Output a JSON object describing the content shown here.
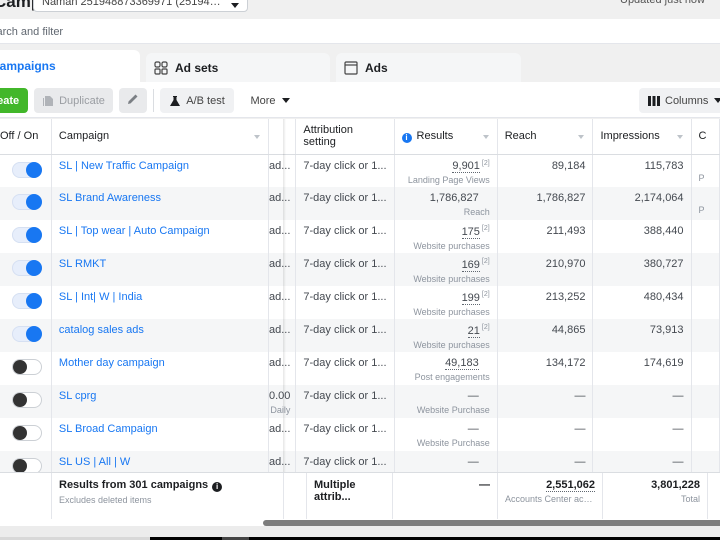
{
  "header": {
    "title": "Campaigns",
    "account_selector": "Naman 251948873369971 (251948873...",
    "updated_status": "Updated just now"
  },
  "search": {
    "placeholder": "Search and filter"
  },
  "tabs": [
    {
      "label": "Campaigns",
      "icon": "campaigns-icon",
      "active": true
    },
    {
      "label": "Ad sets",
      "icon": "grid-icon",
      "active": false
    },
    {
      "label": "Ads",
      "icon": "ad-window-icon",
      "active": false
    }
  ],
  "toolbar": {
    "create_label": "Create",
    "duplicate_label": "Duplicate",
    "edit_icon": "pencil-icon",
    "ab_test_label": "A/B test",
    "more_label": "More",
    "columns_label": "Columns"
  },
  "table": {
    "columns": {
      "toggle": "Off / On",
      "campaign": "Campaign",
      "budget": "",
      "attribution": "Attribution setting",
      "results": "Results",
      "reach": "Reach",
      "impressions": "Impressions",
      "next": "C"
    },
    "rows": [
      {
        "on": true,
        "name": "SL | New Traffic Campaign",
        "budget": "ad...",
        "budget_sub": "",
        "attribution": "7-day click or 1...",
        "result": "9,901",
        "result_note": "[2]",
        "result_type": "Landing Page Views",
        "reach": "89,184",
        "impressions": "115,783",
        "next_sub": "P"
      },
      {
        "on": true,
        "name": "SL Brand Awareness",
        "budget": "ad...",
        "budget_sub": "",
        "attribution": "7-day click or 1...",
        "result": "1,786,827",
        "result_note": "",
        "result_type": "Reach",
        "reach": "1,786,827",
        "impressions": "2,174,064",
        "next_sub": "P"
      },
      {
        "on": true,
        "name": "SL | Top wear | Auto Campaign",
        "budget": "ad...",
        "budget_sub": "",
        "attribution": "7-day click or 1...",
        "result": "175",
        "result_note": "[2]",
        "result_type": "Website purchases",
        "reach": "211,493",
        "impressions": "388,440",
        "next_sub": ""
      },
      {
        "on": true,
        "name": "SL RMKT",
        "budget": "ad...",
        "budget_sub": "",
        "attribution": "7-day click or 1...",
        "result": "169",
        "result_note": "[2]",
        "result_type": "Website purchases",
        "reach": "210,970",
        "impressions": "380,727",
        "next_sub": ""
      },
      {
        "on": true,
        "name": "SL | Int| W | India",
        "budget": "ad...",
        "budget_sub": "",
        "attribution": "7-day click or 1...",
        "result": "199",
        "result_note": "[2]",
        "result_type": "Website purchases",
        "reach": "213,252",
        "impressions": "480,434",
        "next_sub": ""
      },
      {
        "on": true,
        "name": "catalog sales ads",
        "budget": "ad...",
        "budget_sub": "",
        "attribution": "7-day click or 1...",
        "result": "21",
        "result_note": "[2]",
        "result_type": "Website purchases",
        "reach": "44,865",
        "impressions": "73,913",
        "next_sub": ""
      },
      {
        "on": false,
        "name": "Mother day campaign",
        "budget": "ad...",
        "budget_sub": "",
        "attribution": "7-day click or 1...",
        "result": "49,183",
        "result_note": "",
        "result_type": "Post engagements",
        "reach": "134,172",
        "impressions": "174,619",
        "next_sub": ""
      },
      {
        "on": false,
        "name": "SL cprg",
        "budget": "0.00",
        "budget_sub": "Daily",
        "attribution": "7-day click or 1...",
        "result": "—",
        "result_note": "",
        "result_type": "Website Purchase",
        "reach": "—",
        "impressions": "—",
        "next_sub": ""
      },
      {
        "on": false,
        "name": "SL Broad Campaign",
        "budget": "ad...",
        "budget_sub": "",
        "attribution": "7-day click or 1...",
        "result": "—",
        "result_note": "",
        "result_type": "Website Purchase",
        "reach": "—",
        "impressions": "—",
        "next_sub": ""
      },
      {
        "on": false,
        "name": "SL US | All | W",
        "budget": "ad...",
        "budget_sub": "",
        "attribution": "7-day click or 1...",
        "result": "—",
        "result_note": "",
        "result_type": "",
        "reach": "—",
        "impressions": "—",
        "next_sub": ""
      }
    ],
    "summary": {
      "label": "Results from 301 campaigns",
      "sublabel": "Excludes deleted items",
      "attribution": "Multiple attrib...",
      "results": "—",
      "reach": "2,551,062",
      "reach_sub": "Accounts Center acco...",
      "impressions": "3,801,228",
      "impressions_sub": "Total"
    }
  },
  "colors": {
    "accent": "#1877f2",
    "create_button": "#42b72a"
  }
}
